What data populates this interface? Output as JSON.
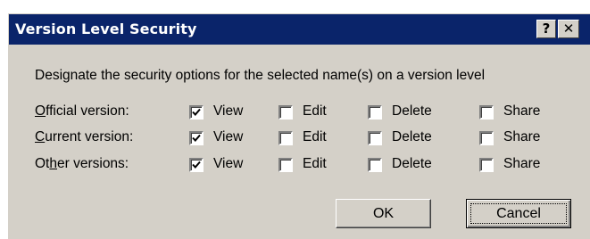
{
  "dialog": {
    "title": "Version Level Security",
    "help_label": "?",
    "close_label": "✕"
  },
  "description": "Designate the security options for the selected name(s) on a version level",
  "rows": [
    {
      "label_prefix": "",
      "mnemonic": "O",
      "label_rest": "fficial version:",
      "view": true,
      "edit": false,
      "delete": false,
      "share": false
    },
    {
      "label_prefix": "",
      "mnemonic": "C",
      "label_rest": "urrent version:",
      "view": true,
      "edit": false,
      "delete": false,
      "share": false
    },
    {
      "label_prefix": "Ot",
      "mnemonic": "h",
      "label_rest": "er versions:",
      "view": true,
      "edit": false,
      "delete": false,
      "share": false
    }
  ],
  "options": {
    "view": "View",
    "edit": "Edit",
    "delete": "Delete",
    "share": "Share"
  },
  "buttons": {
    "ok": "OK",
    "cancel": "Cancel"
  }
}
